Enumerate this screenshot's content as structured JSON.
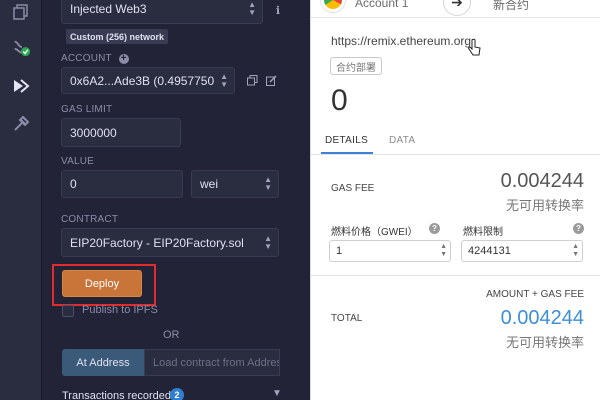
{
  "colors": {
    "panel_bg": "#222336",
    "deploy_button": "#c97539",
    "highlight_frame": "#e02c2c",
    "at_address_button": "#3b5a7a",
    "badge_blue": "#2f7fd0",
    "total_blue": "#3d8fd6"
  },
  "rail": {
    "icons": [
      "file-explorer-icon",
      "compile-icon",
      "deploy-run-icon",
      "debug-plugin-icon"
    ]
  },
  "deploy_panel": {
    "environment": {
      "value": "Injected Web3"
    },
    "network_badge": "Custom (256) network",
    "account": {
      "label": "ACCOUNT",
      "value": "0x6A2...Ade3B (0.4957750"
    },
    "gas_limit": {
      "label": "GAS LIMIT",
      "value": "3000000"
    },
    "value": {
      "label": "VALUE",
      "amount": "0",
      "unit": "wei"
    },
    "contract": {
      "label": "CONTRACT",
      "value": "EIP20Factory - EIP20Factory.sol"
    },
    "deploy_button": "Deploy",
    "publish_ipfs": "Publish to IPFS",
    "or_text": "OR",
    "at_address_button": "At Address",
    "load_contract_placeholder": "Load contract from Address",
    "transactions": {
      "label": "Transactions recorded",
      "count": "2"
    }
  },
  "metamask": {
    "account_name": "Account 1",
    "new_contract": "新合约",
    "origin": "https://remix.ethereum.org",
    "tag": "合约部署",
    "amount": "0",
    "tabs": {
      "details": "DETAILS",
      "data": "DATA"
    },
    "gas_fee": {
      "label": "GAS FEE",
      "value": "0.004244",
      "conversion": "无可用转换率"
    },
    "gas_price": {
      "label": "燃料价格（GWEI）",
      "value": "1"
    },
    "gas_limit": {
      "label": "燃料限制",
      "value": "4244131"
    },
    "amount_gas_label": "AMOUNT + GAS FEE",
    "total": {
      "label": "TOTAL",
      "value": "0.004244",
      "conversion": "无可用转换率"
    }
  }
}
